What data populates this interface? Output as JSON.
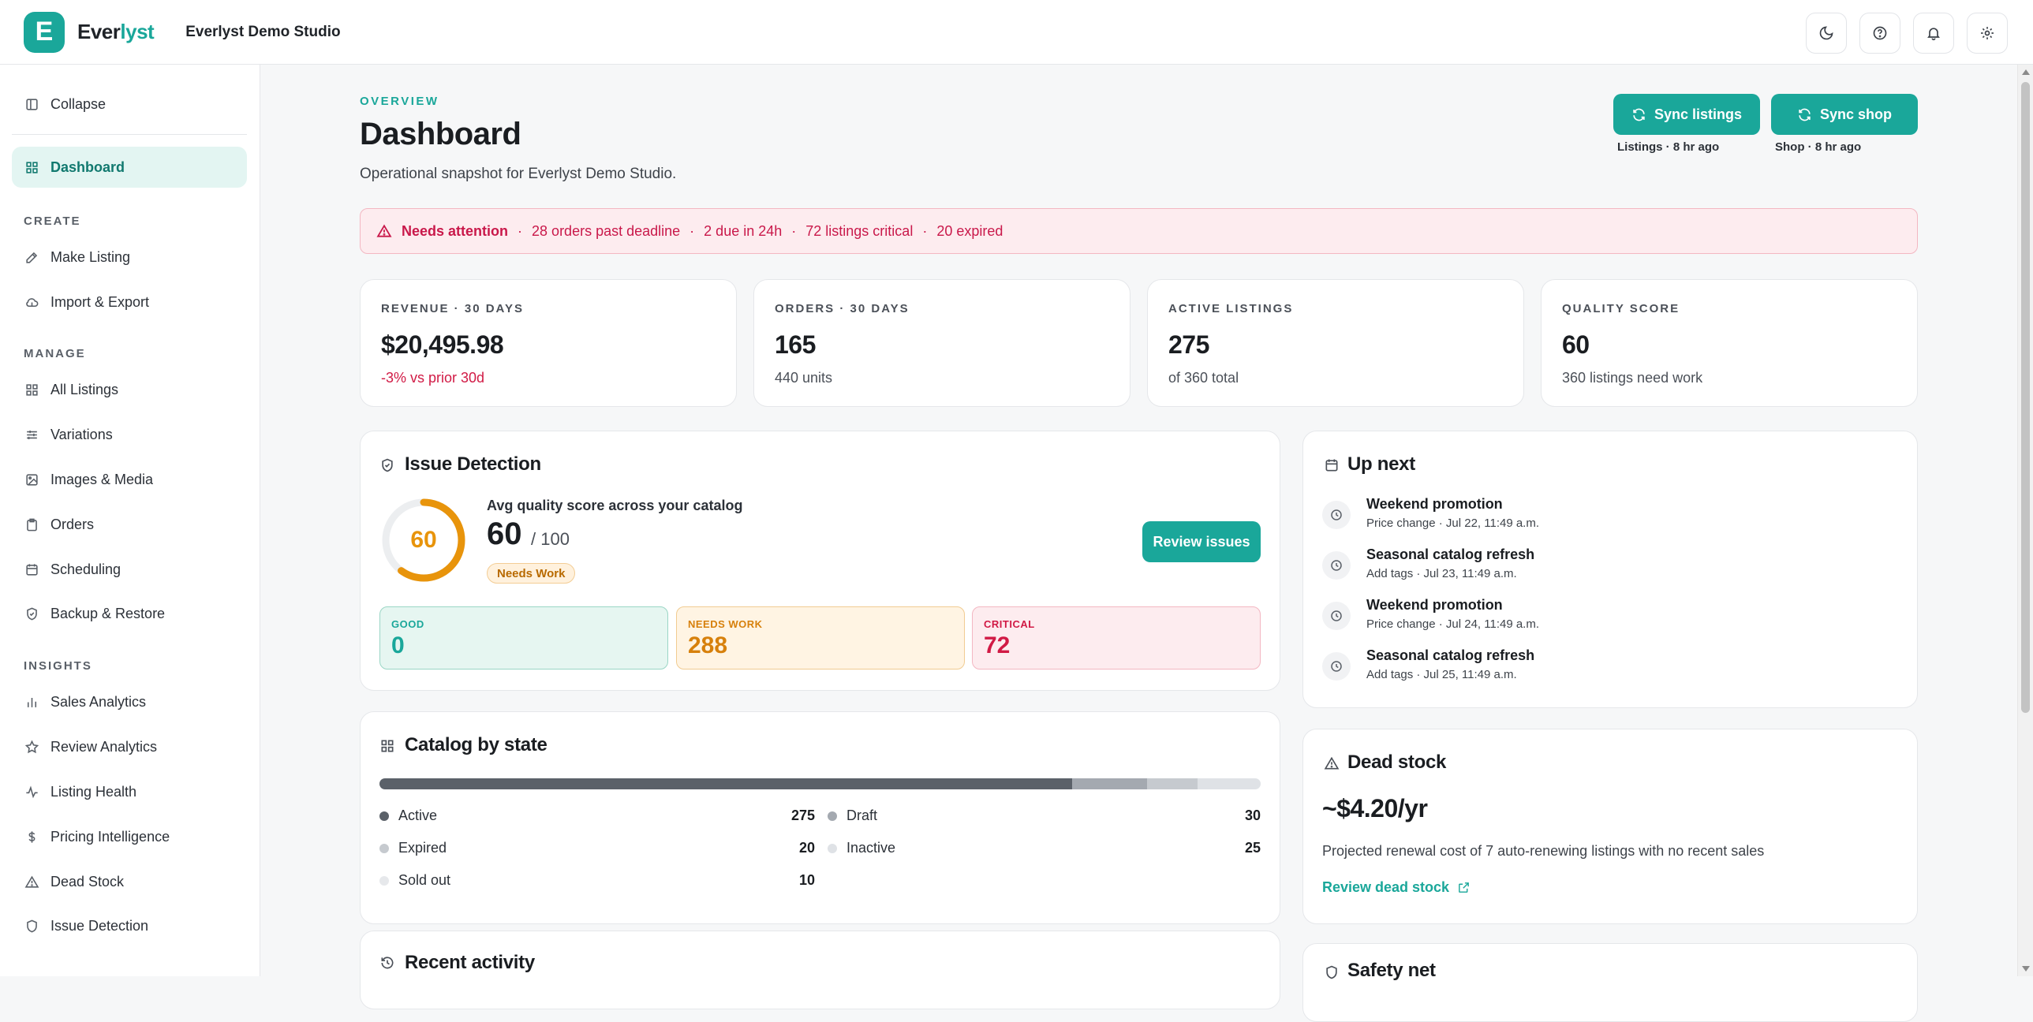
{
  "app": {
    "logo_letter": "E",
    "brand_prefix": "Ever",
    "brand_suffix": "lyst",
    "studio_name": "Everlyst Demo Studio"
  },
  "topbar_icons": [
    "moon-icon",
    "help-icon",
    "bell-icon",
    "gear-icon"
  ],
  "sidebar": {
    "collapse_label": "Collapse",
    "dashboard_label": "Dashboard",
    "sections": {
      "create": "CREATE",
      "manage": "MANAGE",
      "insights": "INSIGHTS"
    },
    "create_items": [
      {
        "label": "Make Listing",
        "icon": "edit-icon"
      },
      {
        "label": "Import & Export",
        "icon": "cloud-icon"
      }
    ],
    "manage_items": [
      {
        "label": "All Listings",
        "icon": "grid-icon"
      },
      {
        "label": "Variations",
        "icon": "sliders-icon"
      },
      {
        "label": "Images & Media",
        "icon": "image-icon"
      },
      {
        "label": "Orders",
        "icon": "clipboard-icon"
      },
      {
        "label": "Scheduling",
        "icon": "calendar-icon"
      },
      {
        "label": "Backup & Restore",
        "icon": "shield-check-icon"
      }
    ],
    "insights_items": [
      {
        "label": "Sales Analytics",
        "icon": "bar-chart-icon"
      },
      {
        "label": "Review Analytics",
        "icon": "star-icon"
      },
      {
        "label": "Listing Health",
        "icon": "activity-icon"
      },
      {
        "label": "Pricing Intelligence",
        "icon": "dollar-icon"
      },
      {
        "label": "Dead Stock",
        "icon": "warning-icon"
      },
      {
        "label": "Issue Detection",
        "icon": "shield-icon"
      }
    ]
  },
  "header": {
    "eyebrow": "OVERVIEW",
    "title": "Dashboard",
    "subtitle": "Operational snapshot for Everlyst Demo Studio.",
    "sync_listings_label": "Sync listings",
    "sync_listings_meta": "Listings · 8 hr ago",
    "sync_shop_label": "Sync shop",
    "sync_shop_meta": "Shop · 8 hr ago"
  },
  "alert": {
    "title": "Needs attention",
    "items": [
      "28 orders past deadline",
      "2 due in 24h",
      "72 listings critical",
      "20 expired"
    ]
  },
  "kpis": [
    {
      "label": "REVENUE · 30 DAYS",
      "value": "$20,495.98",
      "sub": "-3% vs prior 30d",
      "negative": true
    },
    {
      "label": "ORDERS · 30 DAYS",
      "value": "165",
      "sub": "440 units",
      "negative": false
    },
    {
      "label": "ACTIVE LISTINGS",
      "value": "275",
      "sub": "of 360 total",
      "negative": false
    },
    {
      "label": "QUALITY SCORE",
      "value": "60",
      "sub": "360 listings need work",
      "negative": false
    }
  ],
  "issue_detection": {
    "title": "Issue Detection",
    "gauge_value": "60",
    "gauge_fraction": 0.6,
    "caption": "Avg quality score across your catalog",
    "score": "60",
    "score_of": "/ 100",
    "badge": "Needs Work",
    "review_button": "Review issues",
    "tiles": {
      "good_label": "GOOD",
      "good_value": "0",
      "warn_label": "NEEDS WORK",
      "warn_value": "288",
      "crit_label": "CRITICAL",
      "crit_value": "72"
    }
  },
  "up_next": {
    "title": "Up next",
    "items": [
      {
        "title": "Weekend promotion",
        "meta": "Price change · Jul 22, 11:49 a.m."
      },
      {
        "title": "Seasonal catalog refresh",
        "meta": "Add tags · Jul 23, 11:49 a.m."
      },
      {
        "title": "Weekend promotion",
        "meta": "Price change · Jul 24, 11:49 a.m."
      },
      {
        "title": "Seasonal catalog refresh",
        "meta": "Add tags · Jul 25, 11:49 a.m."
      }
    ]
  },
  "catalog": {
    "title": "Catalog by state",
    "states": [
      {
        "name": "Active",
        "value": "275",
        "count": 275,
        "color": "#5b6169"
      },
      {
        "name": "Draft",
        "value": "30",
        "count": 30,
        "color": "#a4a9b0"
      },
      {
        "name": "Expired",
        "value": "20",
        "count": 20,
        "color": "#c6cacf"
      },
      {
        "name": "Inactive",
        "value": "25",
        "count": 25,
        "color": "#dfe2e6"
      },
      {
        "name": "Sold out",
        "value": "10",
        "count": 10,
        "color": "#e6e8eb"
      }
    ]
  },
  "dead_stock": {
    "title": "Dead stock",
    "value": "~$4.20/yr",
    "description": "Projected renewal cost of 7 auto-renewing listings with no recent sales",
    "link": "Review dead stock"
  },
  "recent_activity": {
    "title": "Recent activity"
  },
  "safety_net": {
    "title": "Safety net"
  },
  "colors": {
    "accent": "#1aa79a",
    "danger": "#d11a45",
    "warning": "#e8940b"
  }
}
